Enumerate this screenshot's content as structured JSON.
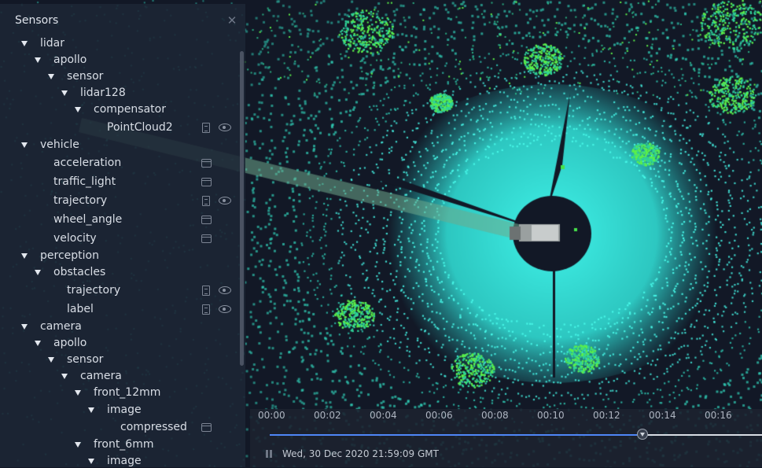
{
  "panel": {
    "title": "Sensors",
    "close_icon": "close-icon"
  },
  "tree": [
    {
      "label": "lidar",
      "depth": 0,
      "expanded": true
    },
    {
      "label": "apollo",
      "depth": 1,
      "expanded": true
    },
    {
      "label": "sensor",
      "depth": 2,
      "expanded": true
    },
    {
      "label": "lidar128",
      "depth": 3,
      "expanded": true
    },
    {
      "label": "compensator",
      "depth": 4,
      "expanded": true
    },
    {
      "label": "PointCloud2",
      "depth": 5,
      "icons": [
        "file-icon",
        "eye-icon"
      ]
    },
    {
      "label": "vehicle",
      "depth": 0,
      "expanded": true
    },
    {
      "label": "acceleration",
      "depth": 1,
      "icons": [
        "panel-icon"
      ]
    },
    {
      "label": "traffic_light",
      "depth": 1,
      "icons": [
        "panel-icon"
      ]
    },
    {
      "label": "trajectory",
      "depth": 1,
      "icons": [
        "file-icon",
        "eye-icon"
      ]
    },
    {
      "label": "wheel_angle",
      "depth": 1,
      "icons": [
        "panel-icon"
      ]
    },
    {
      "label": "velocity",
      "depth": 1,
      "icons": [
        "panel-icon"
      ]
    },
    {
      "label": "perception",
      "depth": 0,
      "expanded": true
    },
    {
      "label": "obstacles",
      "depth": 1,
      "expanded": true
    },
    {
      "label": "trajectory",
      "depth": 2,
      "icons": [
        "file-icon",
        "eye-icon"
      ]
    },
    {
      "label": "label",
      "depth": 2,
      "icons": [
        "file-icon",
        "eye-icon"
      ]
    },
    {
      "label": "camera",
      "depth": 0,
      "expanded": true
    },
    {
      "label": "apollo",
      "depth": 1,
      "expanded": true
    },
    {
      "label": "sensor",
      "depth": 2,
      "expanded": true
    },
    {
      "label": "camera",
      "depth": 3,
      "expanded": true
    },
    {
      "label": "front_12mm",
      "depth": 4,
      "expanded": true
    },
    {
      "label": "image",
      "depth": 5,
      "expanded": true
    },
    {
      "label": "compressed",
      "depth": 6,
      "icons": [
        "panel-icon"
      ]
    },
    {
      "label": "front_6mm",
      "depth": 4,
      "expanded": true
    },
    {
      "label": "image",
      "depth": 5,
      "expanded": true
    }
  ],
  "timeline": {
    "ticks": [
      "00:00",
      "00:02",
      "00:04",
      "00:06",
      "00:08",
      "00:10",
      "00:12",
      "00:14",
      "00:16"
    ],
    "progress_fraction": 0.76,
    "datetime": "Wed, 30 Dec 2020 21:59:09 GMT",
    "pause_icon": "pause-icon"
  },
  "colors": {
    "point_near": "#33f2e0",
    "point_far": "#2fd39a",
    "point_green": "#5cf04a",
    "background": "#121826",
    "panel": "#1d2636",
    "accent": "#4f86f7"
  }
}
